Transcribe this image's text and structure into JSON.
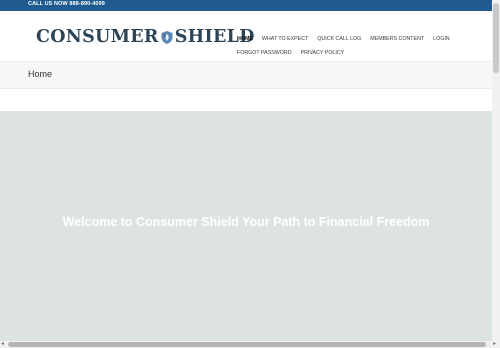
{
  "topbar": {
    "call_text": "CALL US NOW 888-890-4099"
  },
  "logo": {
    "part1": "CONSUMER",
    "part2": "SHIELD"
  },
  "nav": {
    "items": [
      {
        "label": "HOME",
        "active": true
      },
      {
        "label": "WHAT TO EXPECT"
      },
      {
        "label": "QUICK CALL LOG"
      },
      {
        "label": "MEMBERS CONTENT"
      },
      {
        "label": "LOGIN"
      },
      {
        "label": "FORGOT PASSWORD"
      },
      {
        "label": "PRIVACY POLICY"
      }
    ]
  },
  "breadcrumb": {
    "title": "Home"
  },
  "hero": {
    "heading": "Welcome to Consumer Shield Your Path to Financial Freedom"
  },
  "colors": {
    "topbar": "#1f5b8f",
    "logo_text": "#2e4557",
    "shield": "#5b87b3",
    "hero_bg": "#dde3e3"
  },
  "scrollbar": {
    "left_arrow": "◂",
    "right_arrow": "▸"
  }
}
